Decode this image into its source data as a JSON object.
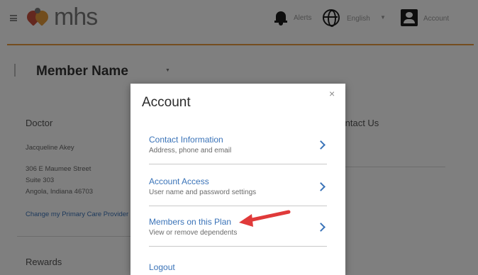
{
  "header": {
    "logo_text": "mhs",
    "alerts_label": "Alerts",
    "language_label": "English",
    "account_label": "Account",
    "accent_color": "#e89b3e"
  },
  "member": {
    "name": "Member Name"
  },
  "doctor": {
    "title": "Doctor",
    "name": "Jacqueline Akey",
    "address_line1": "306 E Maumee Street",
    "address_line2": "Suite 303",
    "address_line3": "Angola, Indiana 46703",
    "change_link": "Change my Primary Care Provider"
  },
  "rewards": {
    "title": "Rewards"
  },
  "contact_us": {
    "title": "Contact Us",
    "link": "Us"
  },
  "modal": {
    "title": "Account",
    "close": "×",
    "items": [
      {
        "label": "Contact Information",
        "subtitle": "Address, phone and email"
      },
      {
        "label": "Account Access",
        "subtitle": "User name and password settings"
      },
      {
        "label": "Members on this Plan",
        "subtitle": "View or remove dependents"
      }
    ],
    "logout": "Logout",
    "link_color": "#3a73b8"
  },
  "annotation": {
    "arrow_color": "#e03a3a"
  }
}
